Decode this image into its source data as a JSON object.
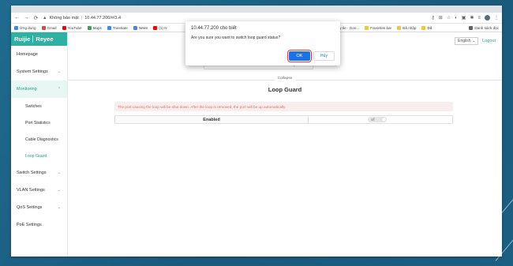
{
  "browser": {
    "url_warning": "Không bảo mật",
    "url": "10.44.77.200/#/3.4",
    "nav": {
      "back": "←",
      "forward": "→",
      "reload": "⟳"
    },
    "bookmarks": [
      {
        "label": "Ứng dụng",
        "color": "#4285f4"
      },
      {
        "label": "Gmail",
        "color": "#ea4335"
      },
      {
        "label": "YouTube",
        "color": "#ff0000"
      },
      {
        "label": "Maps",
        "color": "#34a853"
      },
      {
        "label": "Translate",
        "color": "#4285f4"
      },
      {
        "label": "News",
        "color": "#4285f4"
      },
      {
        "label": "(1) N",
        "color": "#ff0000"
      }
    ],
    "bookmarks_right": [
      {
        "label": "ay tie - Goo...",
        "color": "#4285f4"
      },
      {
        "label": "Favorites bar",
        "color": "#f4c542"
      },
      {
        "label": "Đã nhập",
        "color": "#f4c542"
      },
      {
        "label": "Đã",
        "color": "#f4c542"
      }
    ],
    "reading_list": "Danh sách đọc"
  },
  "sidebar": {
    "brand": "Ruijie",
    "brand2": "Reyee",
    "items": [
      {
        "label": "Homepage",
        "chevron": ""
      },
      {
        "label": "System Settings",
        "chevron": "⌄"
      },
      {
        "label": "Monitoring",
        "chevron": "⌃"
      },
      {
        "label": "Switches"
      },
      {
        "label": "Port Statistics"
      },
      {
        "label": "Cable Diagnostics"
      },
      {
        "label": "Loop Guard"
      },
      {
        "label": "Switch Settings",
        "chevron": "⌄"
      },
      {
        "label": "VLAN Settings",
        "chevron": "⌄"
      },
      {
        "label": "QoS Settings",
        "chevron": "⌄"
      },
      {
        "label": "PoE Settings",
        "chevron": ""
      }
    ]
  },
  "header": {
    "language": "English",
    "logout": "Logout"
  },
  "main": {
    "downlink_label": "Downlink",
    "update_label": "Update",
    "collapse_label": "Collapse",
    "title": "Loop Guard",
    "alert": "The port causing the loop will be shut down. After the loop is removed, the port will be up automatically.",
    "enabled_label": "Enabled",
    "toggle_state": "off"
  },
  "dialog": {
    "title": "10.44.77.200 cho biết",
    "message": "Are you sure you want to switch loop guard status?",
    "ok": "OK",
    "cancel": "Hủy"
  }
}
